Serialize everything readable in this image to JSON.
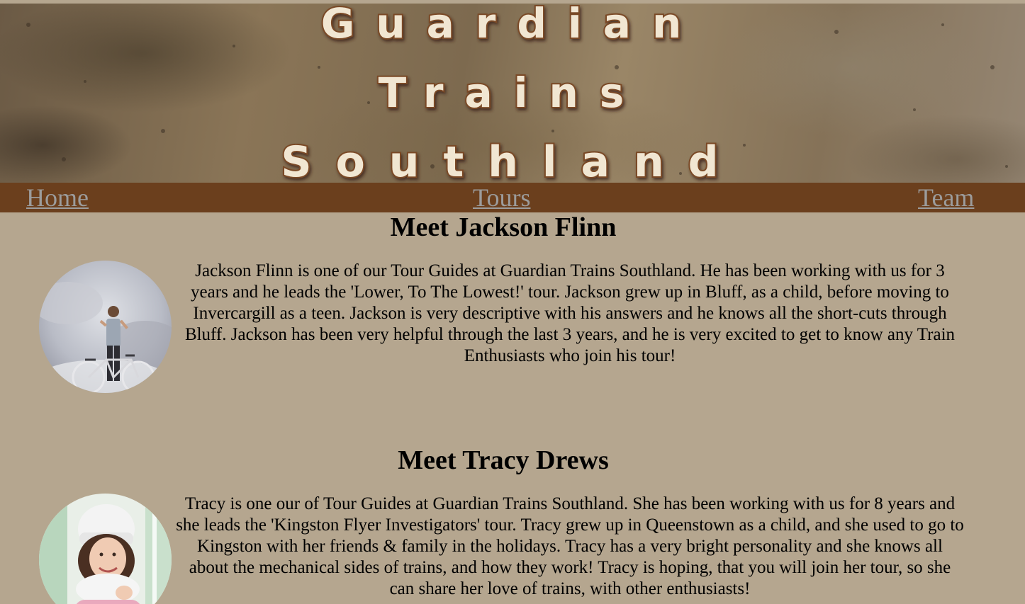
{
  "banner": {
    "line1": "Guardian",
    "line2": "Trains",
    "line3": "Southland"
  },
  "nav": {
    "home": "Home",
    "tours": "Tours",
    "team": "Team"
  },
  "members": [
    {
      "heading": "Meet Jackson Flinn",
      "bio": "Jackson Flinn is one of our Tour Guides at Guardian Trains Southland. He has been working with us for 3 years and he leads the 'Lower, To The Lowest!' tour. Jackson grew up in Bluff, as a child, before moving to Invercargill as a teen. Jackson is very descriptive with his answers and he knows all the short-cuts through Bluff. Jackson has been very helpful through the last 3 years, and he is very excited to get to know any Train Enthusiasts who join his tour!"
    },
    {
      "heading": "Meet Tracy Drews",
      "bio": "Tracy is one our of Tour Guides at Guardian Trains Southland. She has been working with us for 8 years and she leads the 'Kingston Flyer Investigators' tour. Tracy grew up in Queenstown as a child, and she used to go to Kingston with her friends & family in the holidays. Tracy has a very bright personality and she knows all about the mechanical sides of trains, and how they work! Tracy is hoping, that you will join her tour, so she can share her love of trains, with other enthusiasts!"
    }
  ],
  "colors": {
    "background": "#b5a68f",
    "nav_bar": "#6b3f1d",
    "nav_link": "#9c9c9c",
    "banner_letter_fill": "#f1e6d2",
    "banner_letter_outline": "#7a4a25"
  }
}
